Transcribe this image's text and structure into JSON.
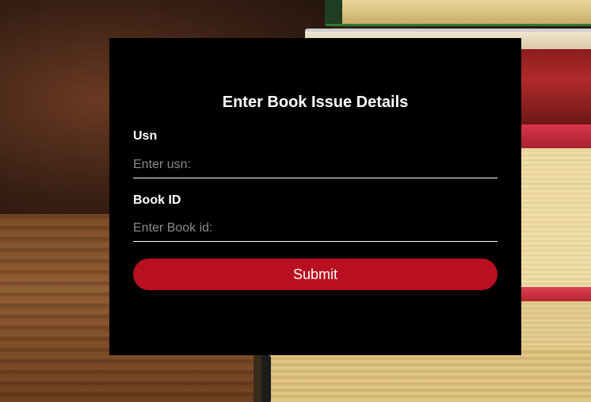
{
  "form": {
    "title": "Enter Book Issue Details",
    "usn": {
      "label": "Usn",
      "placeholder": "Enter usn:",
      "value": ""
    },
    "book_id": {
      "label": "Book ID",
      "placeholder": "Enter Book id:",
      "value": ""
    },
    "submit_label": "Submit"
  },
  "colors": {
    "panel_background": "#000000",
    "submit_button": "#b81020",
    "text": "#ffffff",
    "placeholder": "#8a8a8a"
  }
}
